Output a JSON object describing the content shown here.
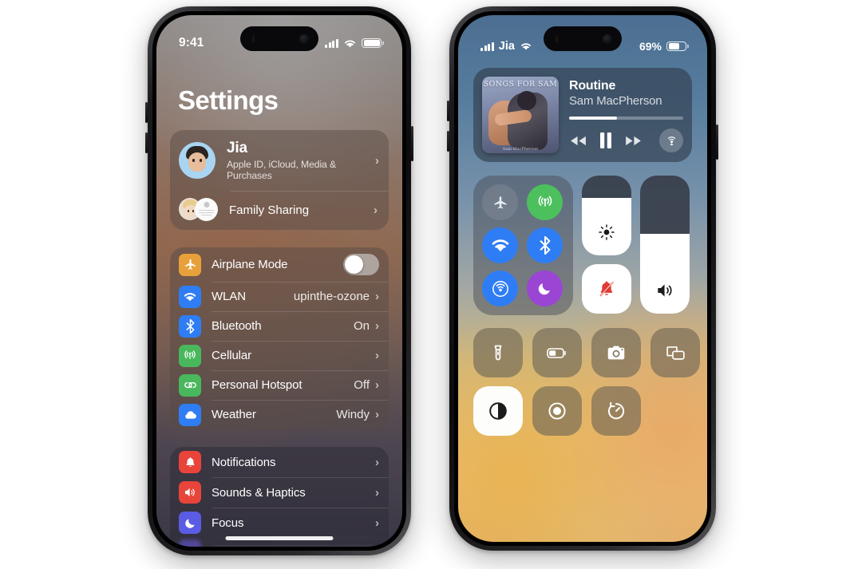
{
  "left_phone": {
    "device": "iphone-settings",
    "status_bar": {
      "time": "9:41",
      "signal_icon": "cellular-bars-icon",
      "wifi_icon": "wifi-icon",
      "battery_icon": "battery-icon"
    },
    "page_title": "Settings",
    "account": {
      "name": "Jia",
      "subtitle": "Apple ID, iCloud, Media & Purchases",
      "avatar_icon": "memoji-avatar",
      "chevron": "›"
    },
    "family_sharing": {
      "label": "Family Sharing",
      "chevron": "›",
      "avatars_icon": "family-avatars"
    },
    "connectivity": [
      {
        "label": "Airplane Mode",
        "icon": "airplane-icon",
        "color": "#e8a13a",
        "control": "toggle",
        "toggle_on": false
      },
      {
        "label": "WLAN",
        "icon": "wifi-icon",
        "color": "#2f7df4",
        "value": "upinthe-ozone",
        "chevron": "›"
      },
      {
        "label": "Bluetooth",
        "icon": "bluetooth-icon",
        "color": "#2f7df4",
        "value": "On",
        "chevron": "›"
      },
      {
        "label": "Cellular",
        "icon": "cellular-signal-icon",
        "color": "#49b85c",
        "value": "",
        "chevron": "›"
      },
      {
        "label": "Personal Hotspot",
        "icon": "hotspot-link-icon",
        "color": "#49b85c",
        "value": "Off",
        "chevron": "›"
      },
      {
        "label": "Weather",
        "icon": "cloud-icon",
        "color": "#2f7df4",
        "value": "Windy",
        "chevron": "›"
      }
    ],
    "alerts": [
      {
        "label": "Notifications",
        "icon": "bell-icon",
        "color": "#e8443a",
        "chevron": "›"
      },
      {
        "label": "Sounds & Haptics",
        "icon": "speaker-wave-icon",
        "color": "#e8443a",
        "chevron": "›"
      },
      {
        "label": "Focus",
        "icon": "moon-icon",
        "color": "#5b5ce4",
        "chevron": "›"
      }
    ],
    "home_indicator": "home-bar"
  },
  "right_phone": {
    "device": "iphone-control-center",
    "status_bar": {
      "signal_icon": "cellular-bars-icon",
      "carrier": "Jia",
      "wifi_icon": "wifi-icon",
      "battery_percent": "69%",
      "battery_level": 69,
      "battery_icon": "battery-icon"
    },
    "now_playing": {
      "album_art_title": "SONGS FOR SAM",
      "album_art_signature": "Sam MacPherson",
      "track_title": "Routine",
      "artist": "Sam MacPherson",
      "progress_percent": 42,
      "rewind_icon": "rewind-icon",
      "pause_icon": "pause-icon",
      "forward_icon": "fast-forward-icon",
      "airplay_icon": "airplay-audio-icon"
    },
    "connectivity_toggles": [
      {
        "name": "airplane-mode",
        "icon": "airplane-icon",
        "active": false,
        "color": "rgba(130,138,150,0.55)"
      },
      {
        "name": "cellular-data",
        "icon": "cellular-signal-icon",
        "active": true,
        "color": "#4cc05c"
      },
      {
        "name": "wifi",
        "icon": "wifi-icon",
        "active": true,
        "color": "#2f7df4"
      },
      {
        "name": "bluetooth",
        "icon": "bluetooth-icon",
        "active": true,
        "color": "#2f7df4"
      },
      {
        "name": "airdrop",
        "icon": "airdrop-icon",
        "active": true,
        "color": "#2f7df4"
      },
      {
        "name": "focus-moon",
        "icon": "moon-icon",
        "active": true,
        "color": "#9b45d4"
      }
    ],
    "brightness_slider": {
      "name": "brightness-slider",
      "icon": "sun-icon",
      "value_percent": 72
    },
    "volume_slider": {
      "name": "volume-slider",
      "icon": "speaker-wave-icon",
      "value_percent": 58
    },
    "silent_button": {
      "name": "silent-mode-button",
      "icon": "bell-slash-icon",
      "active": true
    },
    "tiles": [
      {
        "name": "flashlight",
        "icon": "flashlight-icon",
        "on": false
      },
      {
        "name": "low-power-mode",
        "icon": "battery-low-icon",
        "on": false
      },
      {
        "name": "camera",
        "icon": "camera-icon",
        "on": false
      },
      {
        "name": "screen-mirroring",
        "icon": "screen-mirroring-icon",
        "on": false
      },
      {
        "name": "dark-mode",
        "icon": "dark-mode-icon",
        "on": true
      },
      {
        "name": "screen-recording",
        "icon": "screen-record-icon",
        "on": false
      },
      {
        "name": "timer",
        "icon": "timer-icon",
        "on": false
      }
    ]
  },
  "theme": {
    "accent_blue": "#2f7df4",
    "accent_green": "#49b85c",
    "accent_red": "#e8443a",
    "accent_orange": "#e8a13a",
    "accent_purple": "#9b45d4"
  }
}
